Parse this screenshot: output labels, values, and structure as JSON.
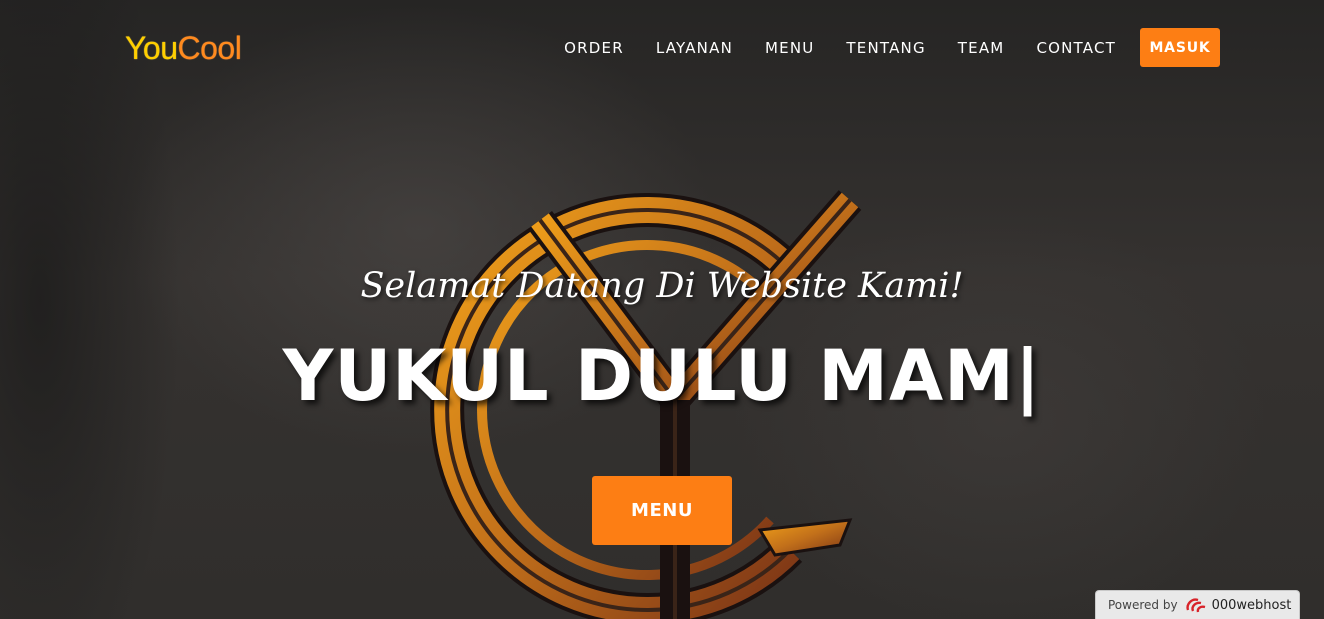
{
  "brand": {
    "part1": "You",
    "part2": "Cool"
  },
  "nav": {
    "items": [
      "ORDER",
      "LAYANAN",
      "MENU",
      "TENTANG",
      "TEAM",
      "CONTACT"
    ],
    "login_label": "MASUK"
  },
  "hero": {
    "subheading": "Selamat Datang Di Website Kami!",
    "heading": "YUKUL DULU MAM|",
    "cta_label": "MENU"
  },
  "badge": {
    "powered": "Powered by",
    "host": "000webhost"
  },
  "colors": {
    "accent": "#fd7e14",
    "brand_yellow": "#ffcf00",
    "background": "#2f2d2c"
  },
  "icons": [
    "youcool-emblem",
    "webhost-logo-icon"
  ]
}
